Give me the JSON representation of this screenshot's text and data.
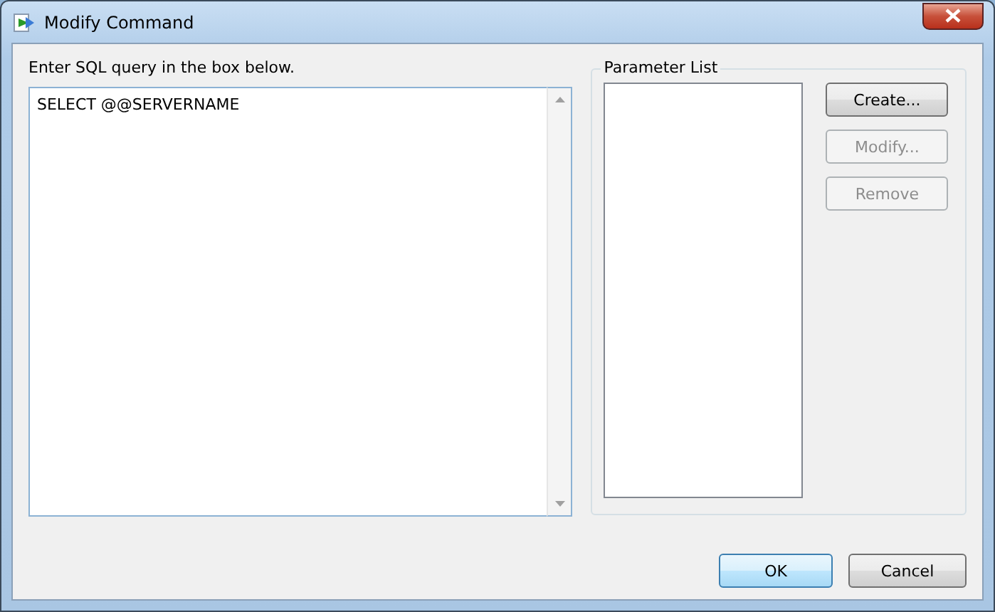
{
  "window": {
    "title": "Modify Command"
  },
  "query": {
    "label": "Enter SQL query in the box below.",
    "value": "SELECT @@SERVERNAME"
  },
  "parameters": {
    "title": "Parameter List",
    "buttons": [
      {
        "label": "Create...",
        "disabled": false
      },
      {
        "label": "Modify...",
        "disabled": true
      },
      {
        "label": "Remove",
        "disabled": true
      }
    ]
  },
  "footer_buttons": [
    {
      "label": "OK",
      "default": true
    },
    {
      "label": "Cancel",
      "default": false
    }
  ]
}
